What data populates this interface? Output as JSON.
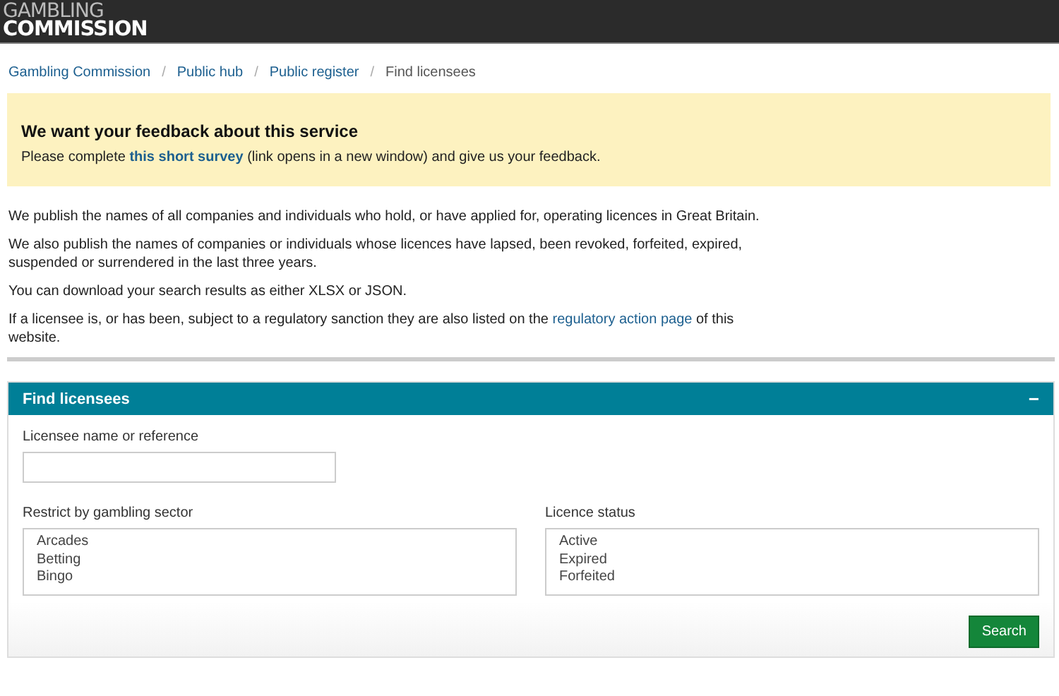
{
  "header": {
    "logo_line_1": "GAMBLING",
    "logo_line_2": "COMMISSION"
  },
  "breadcrumbs": [
    {
      "label": "Gambling Commission",
      "link": true
    },
    {
      "label": "Public hub",
      "link": true
    },
    {
      "label": "Public register",
      "link": true
    },
    {
      "label": "Find licensees",
      "link": false
    }
  ],
  "separator": "/",
  "feedback": {
    "title": "We want your feedback about this service",
    "before": "Please complete ",
    "link": "this short survey",
    "after": " (link opens in a new window) and give us your feedback."
  },
  "paragraphs": [
    {
      "before": "We publish the names of all companies and individuals who hold, or have applied for, operating licences in Great Britain."
    },
    {
      "before": "We also publish the names of companies or individuals whose licences have lapsed, been revoked, forfeited, expired, suspended or surrendered in the last three years."
    },
    {
      "before": "You can download your search results as either XLSX or JSON."
    },
    {
      "before": "If a licensee is, or has been, subject to a regulatory sanction they are also listed on the ",
      "link": "regulatory action page",
      "after": " of this website."
    }
  ],
  "panel": {
    "title": "Find licensees",
    "expanded": true,
    "collapse_icon": "−",
    "name_field": {
      "label": "Licensee name or reference"
    },
    "sector": {
      "label": "Restrict by gambling sector",
      "options": [
        "Arcades",
        "Betting",
        "Bingo"
      ]
    },
    "status": {
      "label": "Licence status",
      "options": [
        "Active",
        "Expired",
        "Forfeited"
      ]
    },
    "search_button": "Search"
  }
}
